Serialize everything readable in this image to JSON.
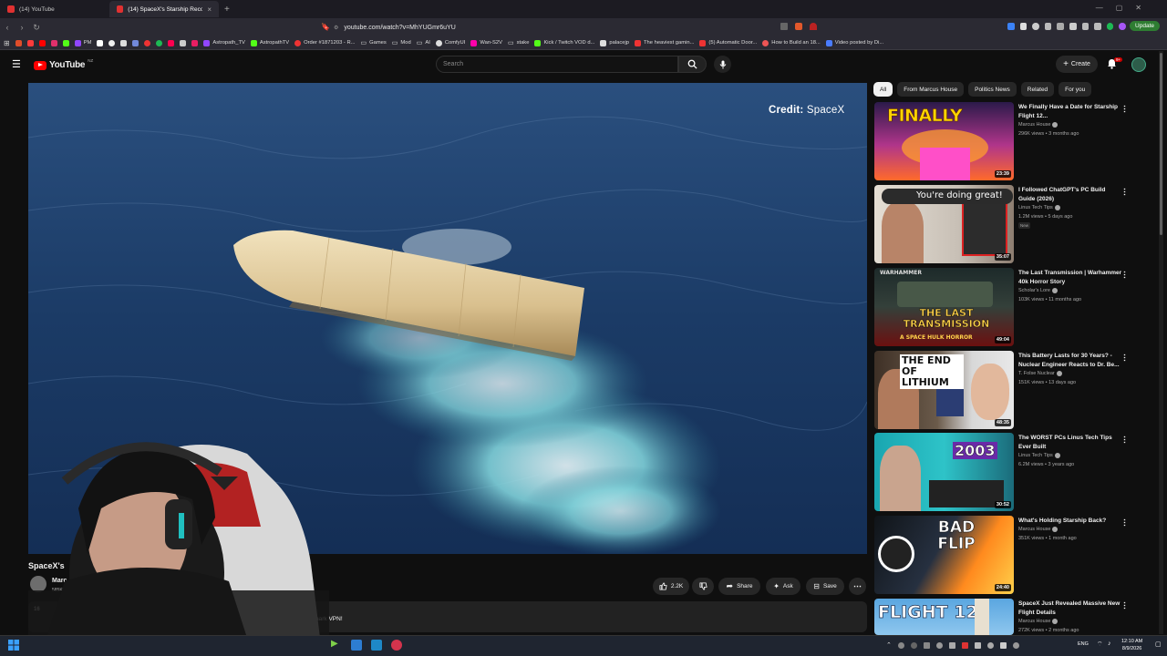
{
  "browser": {
    "tabs": [
      {
        "label": "(14) YouTube",
        "active": false
      },
      {
        "label": "(14) SpaceX's Starship Recov...",
        "active": true
      }
    ],
    "url": "youtube.com/watch?v=MhYUGmr6uYU",
    "update_label": "Update",
    "bookmarks": [
      "PM",
      "Astropath_TV",
      "AstropathTV",
      "Order #1871203 - R...",
      "Games",
      "Mod",
      "AI",
      "ComfyUI",
      "Wan-S2V",
      "stake",
      "Kick / Twitch VOD d...",
      "palacejp",
      "The heaviest gamin...",
      "(5) Automatic Door...",
      "How to Build an 18...",
      "Video posted by Di..."
    ]
  },
  "header": {
    "logo": "YouTube",
    "logo_country": "NZ",
    "search_placeholder": "Search",
    "create_label": "Create",
    "notif_count": "9+"
  },
  "player": {
    "credit_label": "Credit:",
    "credit_value": "SpaceX"
  },
  "video": {
    "title": "SpaceX's",
    "channel": "Marc",
    "subs": "585K",
    "actions": {
      "likes": "2.2K",
      "share": "Share",
      "ask": "Ask",
      "save": "Save"
    },
    "desc_views": "16",
    "desc_sponsor": "hark VPN!"
  },
  "sidebar": {
    "chips": [
      "All",
      "From Marcus House",
      "Politics News",
      "Related",
      "For you"
    ],
    "recommendations": [
      {
        "title": "We Finally Have a Date for Starship Flight 12...",
        "channel": "Marcus House",
        "meta": "296K views • 3 months ago",
        "duration": "23:39",
        "thumb_text": "FINALLY"
      },
      {
        "title": "I Followed ChatGPT's PC Build Guide (2026)",
        "channel": "Linus Tech Tips",
        "meta": "1.2M views • 5 days ago",
        "badge": "New",
        "duration": "35:07",
        "thumb_text": "You're doing great!"
      },
      {
        "title": "The Last Transmission | Warhammer 40k Horror Story",
        "channel": "Scholar's Lore",
        "meta": "103K views • 11 months ago",
        "duration": "49:04",
        "thumb_text": "THE LAST TRANSMISSION",
        "thumb_sub": "A SPACE HULK HORROR",
        "thumb_top": "WARHAMMER"
      },
      {
        "title": "This Battery Lasts for 30 Years? - Nuclear Engineer Reacts to Dr. Be...",
        "channel": "T. Folse Nuclear",
        "meta": "151K views • 13 days ago",
        "duration": "48:35",
        "thumb_text": "THE END OF LITHIUM"
      },
      {
        "title": "The WORST PCs Linus Tech Tips Ever Built",
        "channel": "Linus Tech Tips",
        "meta": "6.2M views • 3 years ago",
        "duration": "30:52",
        "thumb_text": "2003"
      },
      {
        "title": "What's Holding Starship Back?",
        "channel": "Marcus House",
        "meta": "351K views • 1 month ago",
        "duration": "24:40",
        "thumb_text": "BAD FLIP"
      },
      {
        "title": "SpaceX Just Revealed Massive New Flight Details",
        "channel": "Marcus House",
        "meta": "272K views • 2 months ago",
        "duration": "",
        "thumb_text": "FLIGHT 12"
      }
    ]
  },
  "taskbar": {
    "lang": "ENG",
    "time": "12:10 AM",
    "date": "8/9/2026"
  }
}
